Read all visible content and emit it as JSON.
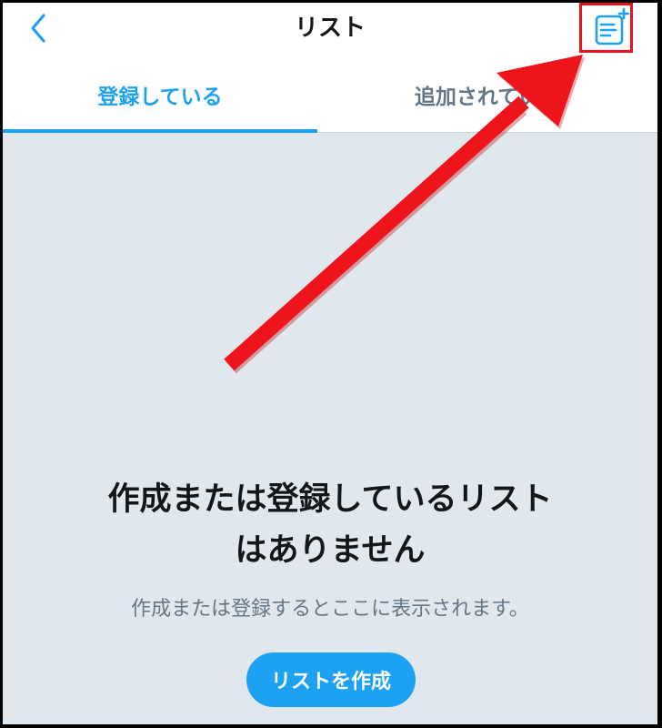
{
  "header": {
    "title": "リスト",
    "back_icon": "chevron-left-icon",
    "new_list_icon": "new-list-icon"
  },
  "tabs": [
    {
      "label": "登録している",
      "active": true
    },
    {
      "label": "追加されている",
      "active": false
    }
  ],
  "empty_state": {
    "title_line1": "作成または登録しているリスト",
    "title_line2": "はありません",
    "subtitle": "作成または登録するとここに表示されます。",
    "button_label": "リストを作成"
  },
  "colors": {
    "accent": "#1da1f2",
    "background": "#e1e8ed",
    "annotation": "#e8141b"
  }
}
